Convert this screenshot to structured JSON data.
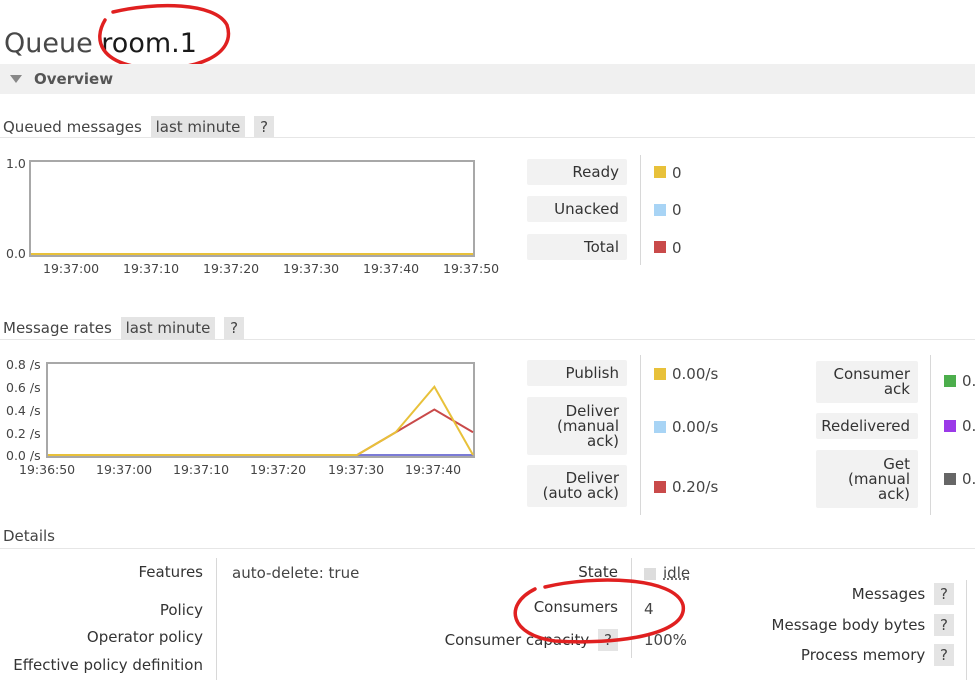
{
  "page": {
    "title_prefix": "Queue",
    "queue_name": "room.1"
  },
  "overview": {
    "label": "Overview"
  },
  "queued_messages": {
    "heading": "Queued messages",
    "range": "last minute",
    "help": "?",
    "y_ticks": [
      "1.0",
      "0.0"
    ],
    "x_ticks": [
      "19:37:00",
      "19:37:10",
      "19:37:20",
      "19:37:30",
      "19:37:40",
      "19:37:50"
    ],
    "legend": [
      {
        "label": "Ready",
        "value": "0",
        "color": "#e8c13a"
      },
      {
        "label": "Unacked",
        "value": "0",
        "color": "#a8d4f5"
      },
      {
        "label": "Total",
        "value": "0",
        "color": "#c94a4a"
      }
    ]
  },
  "message_rates": {
    "heading": "Message rates",
    "range": "last minute",
    "help": "?",
    "y_ticks": [
      "0.8 /s",
      "0.6 /s",
      "0.4 /s",
      "0.2 /s",
      "0.0 /s"
    ],
    "x_ticks": [
      "19:36:50",
      "19:37:00",
      "19:37:10",
      "19:37:20",
      "19:37:30",
      "19:37:40"
    ],
    "legend_left": [
      {
        "label": "Publish",
        "value": "0.00/s",
        "color": "#e8c13a"
      },
      {
        "label": "Deliver (manual ack)",
        "value": "0.00/s",
        "color": "#a8d4f5"
      },
      {
        "label": "Deliver (auto ack)",
        "value": "0.20/s",
        "color": "#c94a4a"
      }
    ],
    "legend_right": [
      {
        "label": "Consumer ack",
        "value": "0.",
        "color": "#4cae4c"
      },
      {
        "label": "Redelivered",
        "value": "0.",
        "color": "#9b3ae8"
      },
      {
        "label": "Get (manual ack)",
        "value": "0.",
        "color": "#666666"
      }
    ]
  },
  "chart_data": [
    {
      "type": "line",
      "title": "Queued messages",
      "x": [
        "19:36:58",
        "19:37:50"
      ],
      "ylim": [
        0,
        1
      ],
      "series": [
        {
          "name": "Ready",
          "color": "#e8c13a",
          "values": [
            0,
            0
          ]
        },
        {
          "name": "Unacked",
          "color": "#a8d4f5",
          "values": [
            0,
            0
          ]
        },
        {
          "name": "Total",
          "color": "#c94a4a",
          "values": [
            0,
            0
          ]
        }
      ]
    },
    {
      "type": "line",
      "title": "Message rates",
      "x": [
        "19:36:50",
        "19:37:30",
        "19:37:35",
        "19:37:40",
        "19:37:45"
      ],
      "ylim": [
        0,
        0.8
      ],
      "series": [
        {
          "name": "Publish",
          "color": "#e8c13a",
          "values": [
            0,
            0,
            0.2,
            0.6,
            0
          ]
        },
        {
          "name": "Deliver (auto ack)",
          "color": "#c94a4a",
          "values": [
            0,
            0,
            0.2,
            0.4,
            0.2
          ]
        },
        {
          "name": "Deliver (manual ack)",
          "color": "#7b7bd6",
          "values": [
            0,
            0,
            0,
            0,
            0
          ]
        }
      ]
    }
  ],
  "details": {
    "heading": "Details",
    "features_label": "Features",
    "feature_key": "auto-delete:",
    "feature_val": "true",
    "policy_label": "Policy",
    "operator_policy_label": "Operator policy",
    "effective_policy_label": "Effective policy definition",
    "state_label": "State",
    "state_value": "idle",
    "consumers_label": "Consumers",
    "consumers_value": "4",
    "capacity_label": "Consumer capacity",
    "capacity_help": "?",
    "capacity_value": "100%",
    "messages_label": "Messages",
    "body_bytes_label": "Message body bytes",
    "process_memory_label": "Process memory",
    "help": "?"
  }
}
